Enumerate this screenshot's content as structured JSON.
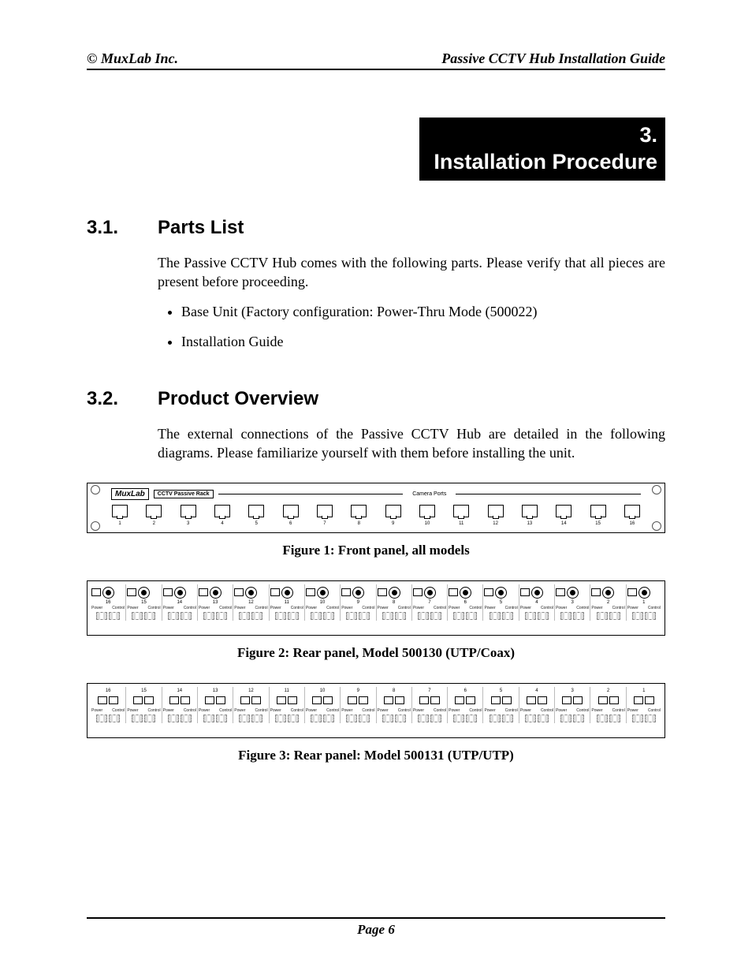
{
  "header": {
    "left": "© MuxLab Inc.",
    "right": "Passive CCTV Hub Installation Guide"
  },
  "chapter": {
    "number": "3.",
    "title": "Installation Procedure"
  },
  "sections": [
    {
      "num": "3.1.",
      "title": "Parts List",
      "intro": "The Passive CCTV Hub comes with the following parts.  Please verify that all pieces are present before proceeding.",
      "bullets": [
        "Base Unit (Factory configuration: Power-Thru Mode (500022)",
        "Installation Guide"
      ]
    },
    {
      "num": "3.2.",
      "title": "Product Overview",
      "intro": "The external connections of the Passive CCTV Hub are detailed in the following diagrams.  Please familiarize yourself with them before installing the unit."
    }
  ],
  "frontpanel": {
    "brand": "MuxLab",
    "product_label": "CCTV Passive Rack",
    "ports_label": "Camera Ports",
    "port_count": 16
  },
  "rearpanel": {
    "module_count": 16,
    "term_labels": {
      "left": "Power",
      "right": "Control"
    }
  },
  "figures": [
    {
      "caption": "Figure 1:  Front panel, all models"
    },
    {
      "caption": "Figure 2: Rear panel, Model 500130 (UTP/Coax)"
    },
    {
      "caption": "Figure 3: Rear panel: Model 500131 (UTP/UTP)"
    }
  ],
  "footer": {
    "page_label": "Page 6"
  }
}
